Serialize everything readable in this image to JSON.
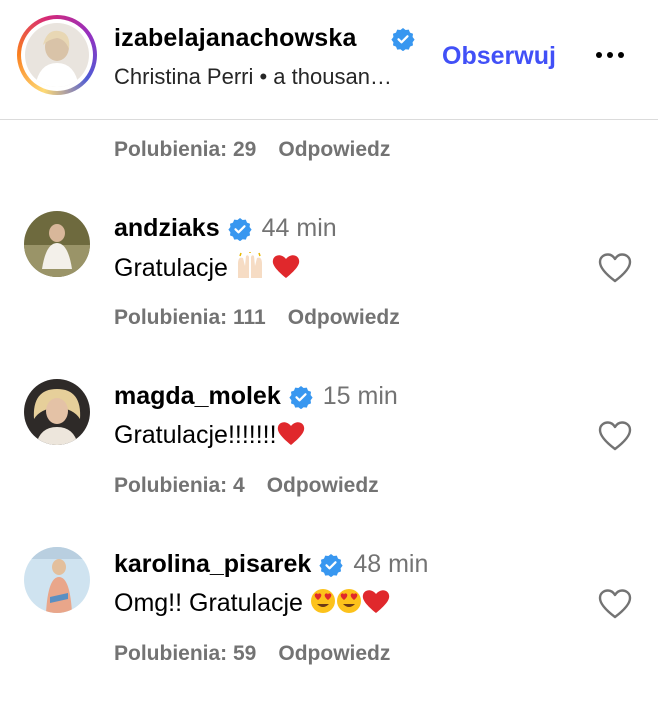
{
  "header": {
    "username": "izabelajanachowska",
    "subtitle": "Christina Perri  •  a thousan…",
    "follow_label": "Obserwuj",
    "verified_icon": "verified-badge-icon",
    "more_icon": "more-options-icon"
  },
  "colors": {
    "accent": "#4150f7",
    "verified": "#3897f0",
    "muted": "#737373",
    "heart": "#e0282c"
  },
  "top_comment_meta": {
    "likes": "Polubienia: 29",
    "reply": "Odpowiedz"
  },
  "comments": [
    {
      "username": "andziaks",
      "time": "44 min",
      "text": "Gratulacje",
      "emojis": [
        "raising-hands-icon",
        "red-heart-icon"
      ],
      "likes": "Polubienia: 111",
      "reply": "Odpowiedz"
    },
    {
      "username": "magda_molek",
      "time": "15 min",
      "text": "Gratulacje!!!!!!!",
      "emojis": [
        "red-heart-icon"
      ],
      "likes": "Polubienia: 4",
      "reply": "Odpowiedz"
    },
    {
      "username": "karolina_pisarek",
      "time": "48 min",
      "text": "Omg!! Gratulacje",
      "emojis": [
        "heart-eyes-icon",
        "heart-eyes-icon",
        "red-heart-icon"
      ],
      "likes": "Polubienia: 59",
      "reply": "Odpowiedz"
    }
  ]
}
